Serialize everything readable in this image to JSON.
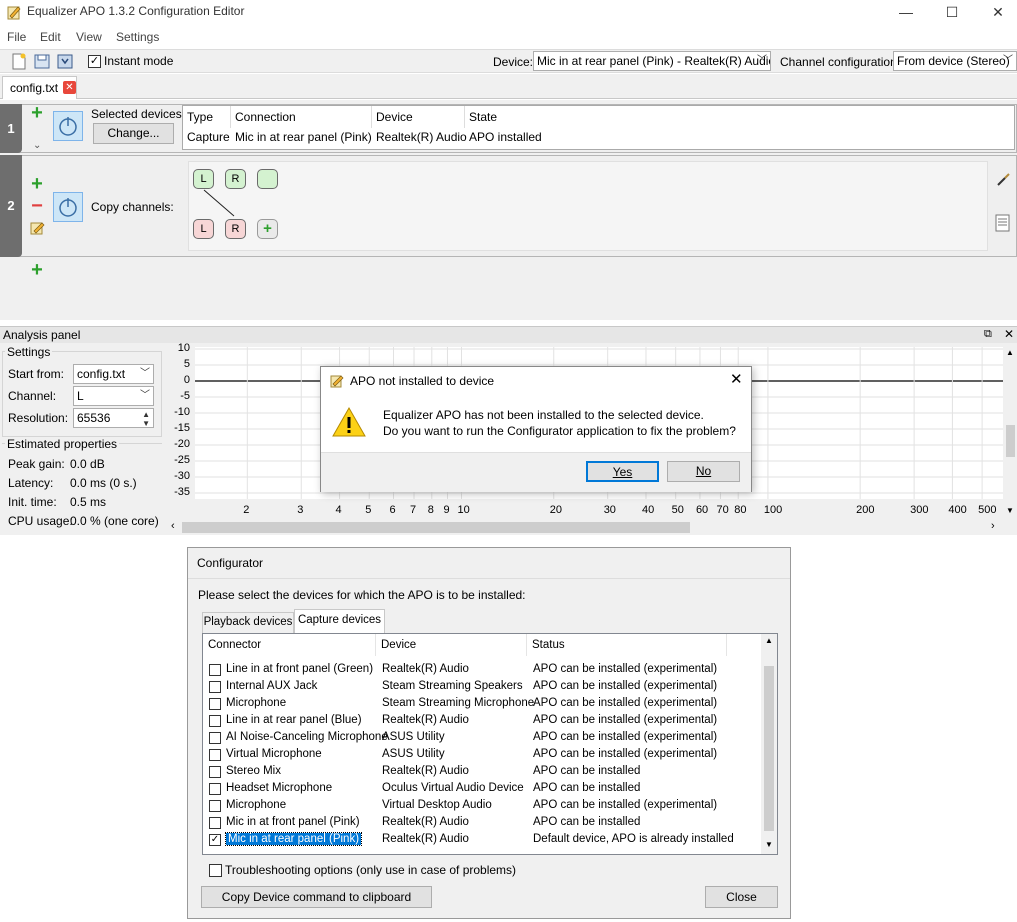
{
  "window": {
    "title": "Equalizer APO 1.3.2 Configuration Editor",
    "controls": {
      "minimize": "—",
      "maximize": "☐",
      "close": "✕"
    }
  },
  "menu": [
    "File",
    "Edit",
    "View",
    "Settings"
  ],
  "toolbar": {
    "instant_mode_label": "Instant mode",
    "instant_mode_checked": true,
    "device_label": "Device:",
    "device_value": "Mic in at rear panel (Pink) - Realtek(R) Audio",
    "channel_config_label": "Channel configuration:",
    "channel_config_value": "From device (Stereo)"
  },
  "tabs": [
    {
      "label": "config.txt"
    }
  ],
  "rows": [
    {
      "number": "1",
      "label": "Selected devices:",
      "change_button": "Change...",
      "table": {
        "headers": [
          "Type",
          "Connection",
          "Device",
          "State"
        ],
        "values": [
          "Capture",
          "Mic in at rear panel (Pink)",
          "Realtek(R) Audio",
          "APO installed"
        ]
      }
    },
    {
      "number": "2",
      "label": "Copy channels:",
      "top_channels": [
        "L",
        "R",
        ""
      ],
      "bottom_channels": [
        "L",
        "R"
      ]
    }
  ],
  "analysis": {
    "header": "Analysis panel",
    "settings_title": "Settings",
    "start_from_label": "Start from:",
    "start_from_value": "config.txt",
    "channel_label": "Channel:",
    "channel_value": "L",
    "resolution_label": "Resolution:",
    "resolution_value": "65536",
    "estimated_title": "Estimated properties",
    "peak_gain_label": "Peak gain:",
    "peak_gain_value": "0.0 dB",
    "latency_label": "Latency:",
    "latency_value": "0.0 ms (0 s.)",
    "init_time_label": "Init. time:",
    "init_time_value": "0.5 ms",
    "cpu_usage_label": "CPU usage:",
    "cpu_usage_value": "0.0 % (one core)",
    "y_ticks": [
      "10",
      "5",
      "0",
      "-5",
      "-10",
      "-15",
      "-20",
      "-25",
      "-30",
      "-35"
    ],
    "x_ticks": [
      "2",
      "3",
      "4",
      "5",
      "6",
      "7",
      "8",
      "9",
      "10",
      "20",
      "30",
      "40",
      "50",
      "60",
      "70",
      "80",
      "100",
      "200",
      "300",
      "400",
      "500"
    ]
  },
  "dialog": {
    "title": "APO not installed to device",
    "line1": "Equalizer APO has not been installed to the selected device.",
    "line2": "Do you want to run the Configurator application to fix the problem?",
    "yes": "Yes",
    "no": "No"
  },
  "configurator": {
    "title": "Configurator",
    "prompt": "Please select the devices for which the APO is to be installed:",
    "tabs": [
      "Playback devices",
      "Capture devices"
    ],
    "headers": [
      "Connector",
      "Device",
      "Status"
    ],
    "rows": [
      {
        "connector": "Line in at front panel (Green)",
        "device": "Realtek(R) Audio",
        "status": "APO can be installed (experimental)",
        "checked": false
      },
      {
        "connector": "Internal AUX Jack",
        "device": "Steam Streaming Speakers",
        "status": "APO can be installed (experimental)",
        "checked": false
      },
      {
        "connector": "Microphone",
        "device": "Steam Streaming Microphone",
        "status": "APO can be installed (experimental)",
        "checked": false
      },
      {
        "connector": "Line in at rear panel (Blue)",
        "device": "Realtek(R) Audio",
        "status": "APO can be installed (experimental)",
        "checked": false
      },
      {
        "connector": "AI Noise-Canceling Microphone",
        "device": "ASUS Utility",
        "status": "APO can be installed (experimental)",
        "checked": false
      },
      {
        "connector": "Virtual Microphone",
        "device": "ASUS Utility",
        "status": "APO can be installed (experimental)",
        "checked": false
      },
      {
        "connector": "Stereo Mix",
        "device": "Realtek(R) Audio",
        "status": "APO can be installed",
        "checked": false
      },
      {
        "connector": "Headset Microphone",
        "device": "Oculus Virtual Audio Device",
        "status": "APO can be installed",
        "checked": false
      },
      {
        "connector": "Microphone",
        "device": "Virtual Desktop Audio",
        "status": "APO can be installed (experimental)",
        "checked": false
      },
      {
        "connector": "Mic in at front panel (Pink)",
        "device": "Realtek(R) Audio",
        "status": "APO can be installed",
        "checked": false
      },
      {
        "connector": "Mic in at rear panel (Pink)",
        "device": "Realtek(R) Audio",
        "status": "Default device, APO is already installed",
        "checked": true
      }
    ],
    "troubleshooting_label": "Troubleshooting options (only use in case of problems)",
    "copy_button": "Copy Device command to clipboard",
    "close_button": "Close"
  },
  "colors": {
    "accent_blue": "#0078d7",
    "power_bg": "#cde6f7",
    "green_plus": "#2da02d",
    "red_minus": "#e04040",
    "row_number_bg": "#6e6e6e"
  }
}
